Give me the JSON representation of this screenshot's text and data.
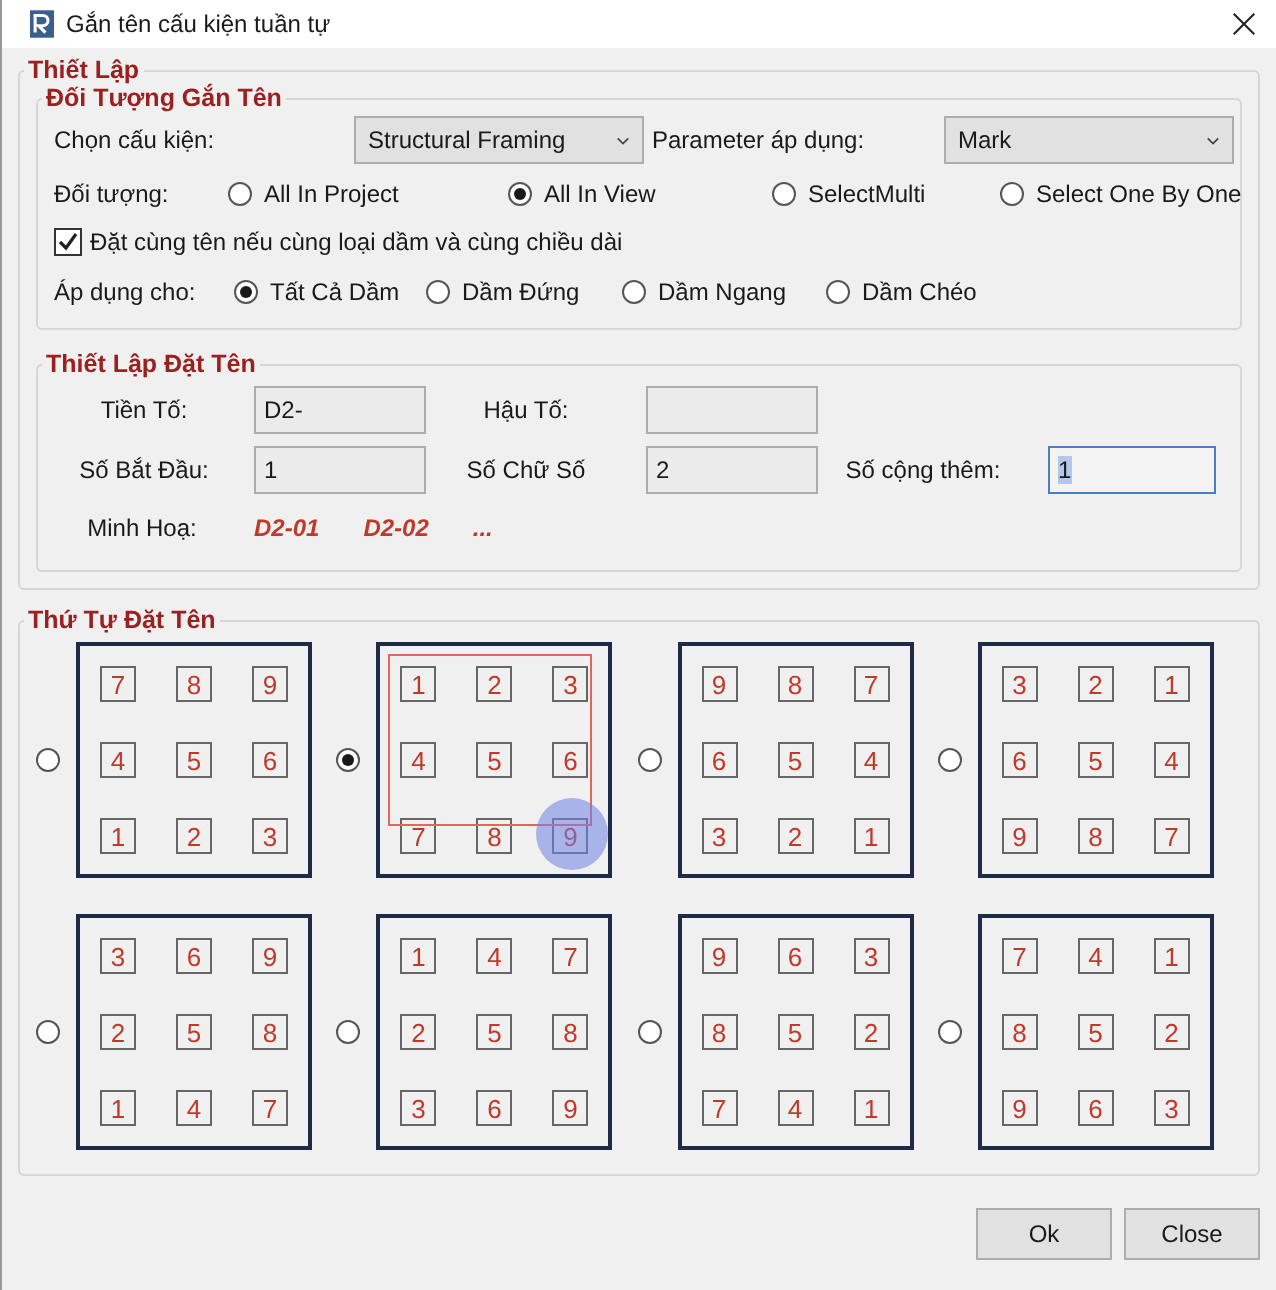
{
  "window": {
    "title": "Gắn tên cấu kiện tuần tự"
  },
  "setup": {
    "title": "Thiết Lập",
    "target": {
      "title": "Đối Tượng Gắn Tên",
      "component_label": "Chọn cấu kiện:",
      "component_value": "Structural Framing",
      "parameter_label": "Parameter áp dụng:",
      "parameter_value": "Mark",
      "scope_label": "Đối tượng:",
      "scope_options": [
        {
          "label": "All In Project",
          "selected": false
        },
        {
          "label": "All In View",
          "selected": true
        },
        {
          "label": "SelectMulti",
          "selected": false
        },
        {
          "label": "Select One By One",
          "selected": false
        }
      ],
      "same_name": {
        "label": "Đặt cùng tên nếu cùng loại dầm và cùng chiều dài",
        "checked": true
      },
      "apply_label": "Áp dụng cho:",
      "apply_options": [
        {
          "label": "Tất Cả Dầm",
          "selected": true
        },
        {
          "label": "Dầm Đứng",
          "selected": false
        },
        {
          "label": "Dầm Ngang",
          "selected": false
        },
        {
          "label": "Dầm Chéo",
          "selected": false
        }
      ]
    },
    "naming": {
      "title": "Thiết Lập Đặt Tên",
      "fields": [
        {
          "label": "Tiền Tố:",
          "value": "D2-",
          "focused": false
        },
        {
          "label": "Hậu Tố:",
          "focused": false
        },
        {
          "label": "Số Bắt Đầu:",
          "value": "1",
          "focused": false
        },
        {
          "label": "Số Chữ Số",
          "value": "2",
          "focused": false
        },
        {
          "label": "Số cộng thêm:",
          "value": "1",
          "focused": true
        }
      ],
      "preview_label": "Minh Hoạ:",
      "preview": [
        "D2-01",
        "D2-02",
        "..."
      ]
    }
  },
  "order": {
    "title": "Thứ Tự Đặt Tên",
    "patterns": [
      {
        "selected": false,
        "cells": [
          "7",
          "8",
          "9",
          "4",
          "5",
          "6",
          "1",
          "2",
          "3"
        ]
      },
      {
        "selected": true,
        "cells": [
          "1",
          "2",
          "3",
          "4",
          "5",
          "6",
          "7",
          "8",
          "9"
        ]
      },
      {
        "selected": false,
        "cells": [
          "9",
          "8",
          "7",
          "6",
          "5",
          "4",
          "3",
          "2",
          "1"
        ]
      },
      {
        "selected": false,
        "cells": [
          "3",
          "2",
          "1",
          "6",
          "5",
          "4",
          "9",
          "8",
          "7"
        ]
      },
      {
        "selected": false,
        "cells": [
          "3",
          "6",
          "9",
          "2",
          "5",
          "8",
          "1",
          "4",
          "7"
        ]
      },
      {
        "selected": false,
        "cells": [
          "1",
          "4",
          "7",
          "2",
          "5",
          "8",
          "3",
          "6",
          "9"
        ]
      },
      {
        "selected": false,
        "cells": [
          "9",
          "6",
          "3",
          "8",
          "5",
          "2",
          "7",
          "4",
          "1"
        ]
      },
      {
        "selected": false,
        "cells": [
          "7",
          "4",
          "1",
          "8",
          "5",
          "2",
          "9",
          "6",
          "3"
        ]
      }
    ]
  },
  "buttons": [
    "Ok",
    "Close"
  ]
}
